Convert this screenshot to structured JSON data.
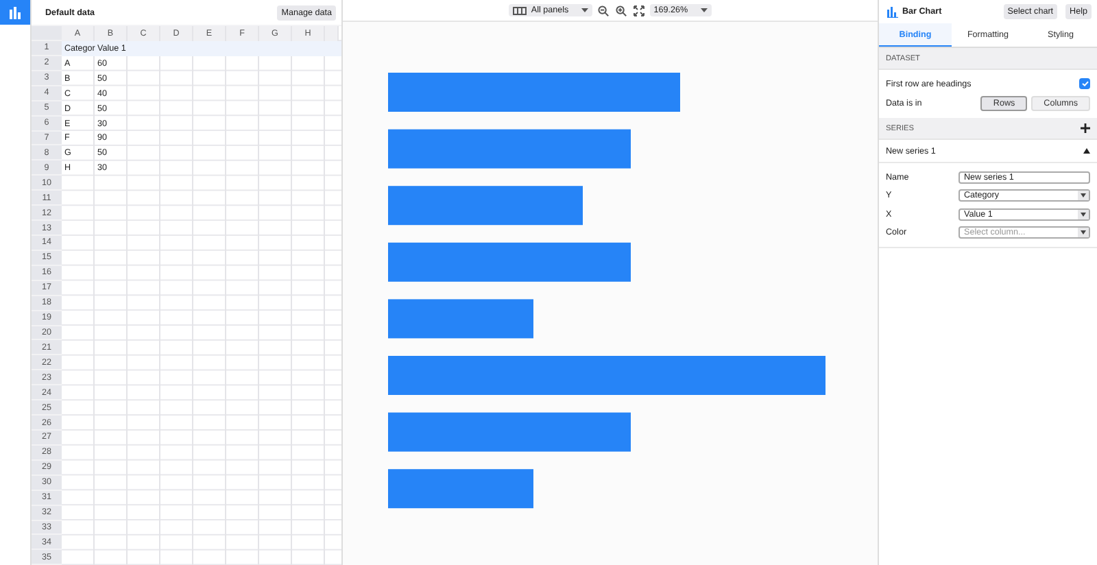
{
  "data_panel": {
    "title": "Default data",
    "manage_button": "Manage data"
  },
  "grid": {
    "columns": [
      "A",
      "B",
      "C",
      "D",
      "E",
      "F",
      "G",
      "H"
    ],
    "rows": [
      {
        "number": "1",
        "header": true,
        "cells": [
          "Categor",
          "Value 1"
        ]
      },
      {
        "number": "2",
        "header": false,
        "cells": [
          "A",
          "60"
        ]
      },
      {
        "number": "3",
        "header": false,
        "cells": [
          "B",
          "50"
        ]
      },
      {
        "number": "4",
        "header": false,
        "cells": [
          "C",
          "40"
        ]
      },
      {
        "number": "5",
        "header": false,
        "cells": [
          "D",
          "50"
        ]
      },
      {
        "number": "6",
        "header": false,
        "cells": [
          "E",
          "30"
        ]
      },
      {
        "number": "7",
        "header": false,
        "cells": [
          "F",
          "90"
        ]
      },
      {
        "number": "8",
        "header": false,
        "cells": [
          "G",
          "50"
        ]
      },
      {
        "number": "9",
        "header": false,
        "cells": [
          "H",
          "30"
        ]
      },
      {
        "number": "10",
        "header": false
      },
      {
        "number": "11",
        "header": false
      },
      {
        "number": "12",
        "header": false
      },
      {
        "number": "13",
        "header": false
      },
      {
        "number": "14",
        "header": false
      },
      {
        "number": "15",
        "header": false
      },
      {
        "number": "16",
        "header": false
      },
      {
        "number": "17",
        "header": false
      },
      {
        "number": "18",
        "header": false
      },
      {
        "number": "19",
        "header": false
      },
      {
        "number": "20",
        "header": false
      },
      {
        "number": "21",
        "header": false
      },
      {
        "number": "22",
        "header": false
      },
      {
        "number": "23",
        "header": false
      },
      {
        "number": "24",
        "header": false
      },
      {
        "number": "25",
        "header": false
      },
      {
        "number": "26",
        "header": false
      },
      {
        "number": "27",
        "header": false
      },
      {
        "number": "28",
        "header": false
      },
      {
        "number": "29",
        "header": false
      },
      {
        "number": "30",
        "header": false
      },
      {
        "number": "31",
        "header": false
      },
      {
        "number": "32",
        "header": false
      },
      {
        "number": "33",
        "header": false
      },
      {
        "number": "34",
        "header": false
      },
      {
        "number": "35",
        "header": false
      }
    ]
  },
  "toolbar": {
    "panels": "All panels",
    "zoom": "169.26%"
  },
  "inspector": {
    "title": "Bar Chart",
    "buttons": [
      "Select chart",
      "Help"
    ],
    "tabs": [
      {
        "label": "Binding",
        "selected": true
      },
      {
        "label": "Formatting",
        "selected": false
      },
      {
        "label": "Styling",
        "selected": false
      }
    ],
    "dataset": {
      "heading": "DATASET",
      "first_row_label": "First row are headings",
      "first_row_checked": true,
      "data_in_label": "Data is in",
      "options": [
        {
          "label": "Rows",
          "selected": true
        },
        {
          "label": "Columns",
          "selected": false
        }
      ]
    },
    "series": {
      "heading": "SERIES",
      "name": "New series 1",
      "expanded": true,
      "fields": [
        {
          "label": "Name",
          "kind": "text",
          "value": "New series 1"
        },
        {
          "label": "Y",
          "kind": "select",
          "value": "Category"
        },
        {
          "label": "X",
          "kind": "select",
          "value": "Value 1"
        },
        {
          "label": "Color",
          "kind": "select",
          "placeholder": "Select column..."
        }
      ]
    }
  }
}
